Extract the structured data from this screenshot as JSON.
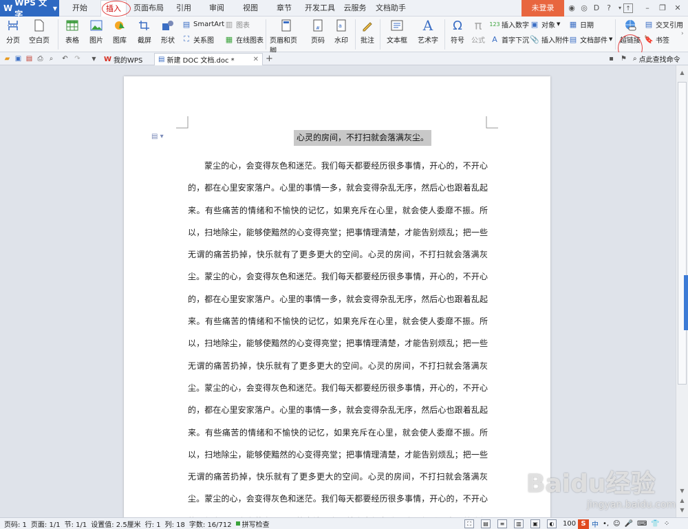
{
  "app": {
    "name": "WPS 文字"
  },
  "menu": {
    "tabs": [
      {
        "label": "开始"
      },
      {
        "label": "插入",
        "active": true
      },
      {
        "label": "页面布局"
      },
      {
        "label": "引用"
      },
      {
        "label": "审阅"
      },
      {
        "label": "视图"
      },
      {
        "label": "章节"
      },
      {
        "label": "开发工具"
      },
      {
        "label": "云服务"
      },
      {
        "label": "文档助手"
      }
    ],
    "login": "未登录"
  },
  "ribbon": {
    "page_break": "分页",
    "blank_page": "空白页",
    "table": "表格",
    "picture": "图片",
    "gallery": "图库",
    "screenshot": "截屏",
    "shape": "形状",
    "smartart": "SmartArt",
    "relation": "关系图",
    "chart": "图表",
    "online_chart": "在线图表",
    "header_footer": "页眉和页脚",
    "page_number": "页码",
    "watermark": "水印",
    "comment": "批注",
    "textbox": "文本框",
    "wordart": "艺术字",
    "symbol": "符号",
    "formula": "公式",
    "insert_number": "插入数字",
    "dropcap": "首字下沉",
    "object": "对象",
    "attachment": "插入附件",
    "date": "日期",
    "doc_parts": "文档部件",
    "hyperlink": "超链接",
    "crossref": "交叉引用",
    "bookmark": "书签"
  },
  "tabbar": {
    "tabs": [
      {
        "label": "我的WPS"
      },
      {
        "label": "新建 DOC 文档.doc *",
        "active": true
      }
    ],
    "command_search": "点此查找命令"
  },
  "document": {
    "title": "心灵的房间，不打扫就会落满灰尘。",
    "body": "蒙尘的心，会变得灰色和迷茫。我们每天都要经历很多事情，开心的，不开心的，都在心里安家落户。心里的事情一多，就会变得杂乱无序，然后心也跟着乱起来。有些痛苦的情绪和不愉快的记忆，如果充斥在心里，就会使人委靡不振。所以，扫地除尘，能够使黯然的心变得亮堂；把事情理清楚，才能告别烦乱；把一些无谓的痛苦扔掉，快乐就有了更多更大的空间。心灵的房间，不打扫就会落满灰尘。蒙尘的心，会变得灰色和迷茫。我们每天都要经历很多事情，开心的，不开心的，都在心里安家落户。心里的事情一多，就会变得杂乱无序，然后心也跟着乱起来。有些痛苦的情绪和不愉快的记忆，如果充斥在心里，就会使人委靡不振。所以，扫地除尘，能够使黯然的心变得亮堂；把事情理清楚，才能告别烦乱；把一些无谓的痛苦扔掉，快乐就有了更多更大的空间。心灵的房间，不打扫就会落满灰尘。蒙尘的心，会变得灰色和迷茫。我们每天都要经历很多事情，开心的，不开心的，都在心里安家落户。心里的事情一多，就会变得杂乱无序，然后心也跟着乱起来。有些痛苦的情绪和不愉快的记忆，如果充斥在心里，就会使人委靡不振。所以，扫地除尘，能够使黯然的心变得亮堂；把事情理清楚，才能告别烦乱；把一些无谓的痛苦扔掉，快乐就有了更多更大的空间。心灵的房间，不打扫就会落满灰尘。蒙尘的心，会变得灰色和迷茫。我们每天都要经历很多事情，开心的，不开心的，都在心里安家落户。心里的事情一多，就会变得杂乱无序，然后心也跟着乱起来。"
  },
  "statusbar": {
    "page_code": "页码: 1",
    "pages": "页面: 1/1",
    "section": "节: 1/1",
    "setting": "设置值: 2.5厘米",
    "row": "行: 1",
    "col": "列: 18",
    "words": "字数: 16/712",
    "spell": "拼写检查",
    "zoom": "100 %"
  },
  "watermark": {
    "brand": "Baidu经验",
    "url": "jingyan.baidu.com"
  },
  "ime": {
    "mode": "中"
  }
}
